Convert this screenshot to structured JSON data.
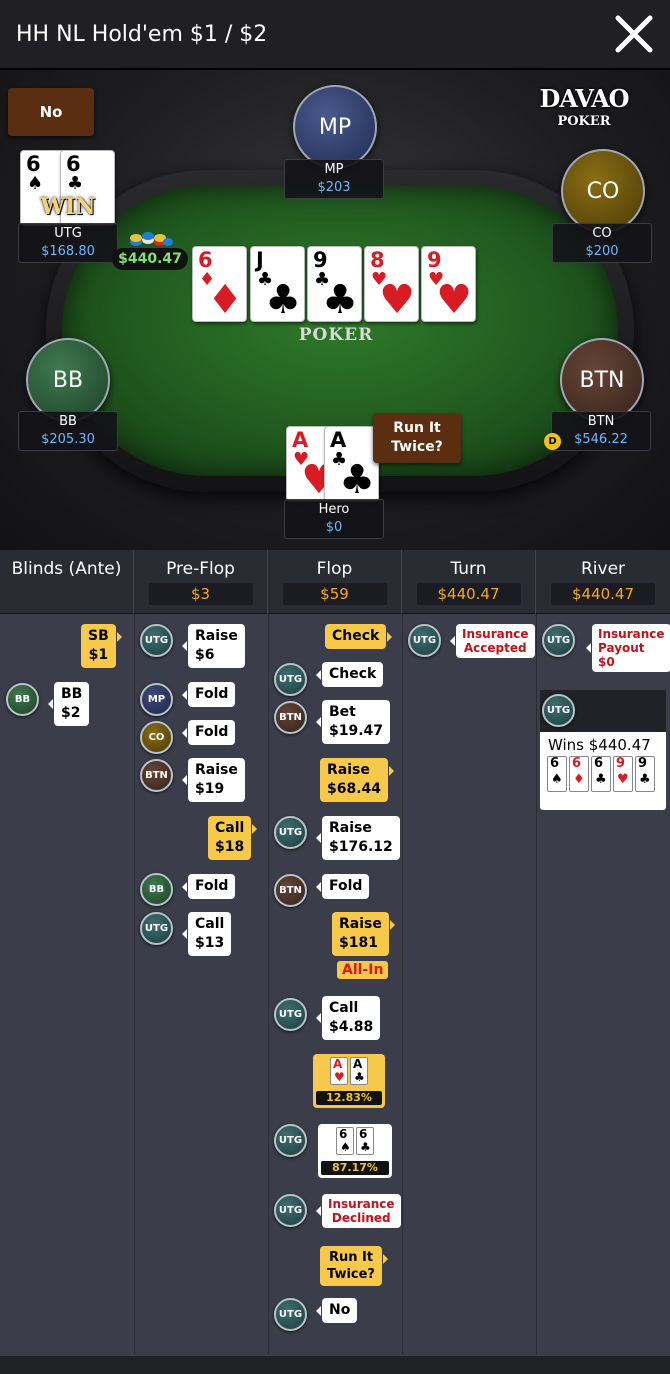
{
  "header": {
    "title": "HH NL Hold'em $1 / $2"
  },
  "brand": {
    "line1": "DAVAO",
    "line2": "POKER"
  },
  "felt_logo": "POKER",
  "seats": {
    "utg": {
      "name": "UTG",
      "stack": "$168.80",
      "c1r": "6",
      "c1s": "♠",
      "c2r": "6",
      "c2s": "♣",
      "win_label": "WIN",
      "bubble": "No"
    },
    "mp": {
      "avatar": "MP",
      "name": "MP",
      "stack": "$203"
    },
    "co": {
      "avatar": "CO",
      "name": "CO",
      "stack": "$200"
    },
    "bb": {
      "avatar": "BB",
      "name": "BB",
      "stack": "$205.30"
    },
    "btn": {
      "avatar": "BTN",
      "name": "BTN",
      "stack": "$546.22",
      "dealer": "D"
    },
    "hero": {
      "name": "Hero",
      "stack": "$0",
      "c1r": "A",
      "c1s": "♥",
      "c2r": "A",
      "c2s": "♣",
      "bubble": "Run It Twice?"
    }
  },
  "pot": "$440.47",
  "board": [
    {
      "r": "6",
      "s": "♦"
    },
    {
      "r": "J",
      "s": "♣"
    },
    {
      "r": "9",
      "s": "♣"
    },
    {
      "r": "8",
      "s": "♥"
    },
    {
      "r": "9",
      "s": "♥"
    }
  ],
  "history": {
    "columns": [
      {
        "title": "Blinds (Ante)",
        "pot": ""
      },
      {
        "title": "Pre-Flop",
        "pot": "$3"
      },
      {
        "title": "Flop",
        "pot": "$59"
      },
      {
        "title": "Turn",
        "pot": "$440.47"
      },
      {
        "title": "River",
        "pot": "$440.47"
      }
    ],
    "blinds": {
      "sb": "SB\n$1",
      "bb_badge": "BB",
      "bb": "BB\n$2"
    },
    "preflop": {
      "a1": "Raise\n$6",
      "a2": "Fold",
      "a3": "Fold",
      "a4": "Raise\n$19",
      "a5": "Call\n$18",
      "a6": "Fold",
      "a7": "Call\n$13"
    },
    "flop": {
      "a1": "Check",
      "a2": "Check",
      "a3": "Bet\n$19.47",
      "a4": "Raise\n$68.44",
      "a5": "Raise\n$176.12",
      "a6": "Fold",
      "a7": "Raise\n$181",
      "allin": "All-In",
      "a8": "Call\n$4.88",
      "eq1": "12.83%",
      "eq2": "87.17%",
      "ins": "Insurance\nDeclined",
      "rit": "Run It\nTwice?",
      "no": "No"
    },
    "turn": {
      "ins": "Insurance\nAccepted"
    },
    "river": {
      "ins": "Insurance\nPayout\n$0",
      "wins": "Wins $440.47"
    },
    "badges": {
      "utg": "UTG",
      "bb": "BB",
      "mp": "MP",
      "co": "CO",
      "btn": "BTN"
    }
  },
  "river_cards": [
    {
      "r": "6",
      "s": "♠"
    },
    {
      "r": "6",
      "s": "♦"
    },
    {
      "r": "6",
      "s": "♣"
    },
    {
      "r": "9",
      "s": "♥"
    },
    {
      "r": "9",
      "s": "♣"
    }
  ]
}
